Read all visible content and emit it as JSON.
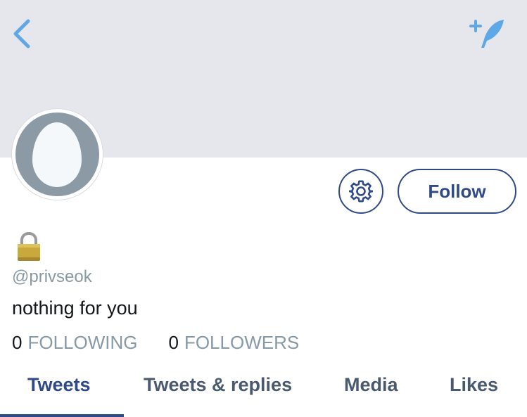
{
  "header": {
    "back_icon": "chevron-left-icon",
    "compose_icon": "feather-sparkle-icon",
    "banner_color": "#e6e7ec"
  },
  "profile": {
    "avatar_icon": "default-egg-avatar",
    "lock_icon": "padlock-emoji",
    "handle": "@privseok",
    "bio": "nothing for you"
  },
  "actions": {
    "settings_icon": "gear-icon",
    "follow_label": "Follow"
  },
  "stats": {
    "following_count": "0",
    "following_label": "FOLLOWING",
    "followers_count": "0",
    "followers_label": "FOLLOWERS"
  },
  "tabs": [
    {
      "label": "Tweets",
      "active": true
    },
    {
      "label": "Tweets & replies",
      "active": false
    },
    {
      "label": "Media",
      "active": false
    },
    {
      "label": "Likes",
      "active": false
    }
  ],
  "colors": {
    "accent": "#2f4a87",
    "icon_blue": "#5ea8e8",
    "muted": "#8899a6"
  }
}
